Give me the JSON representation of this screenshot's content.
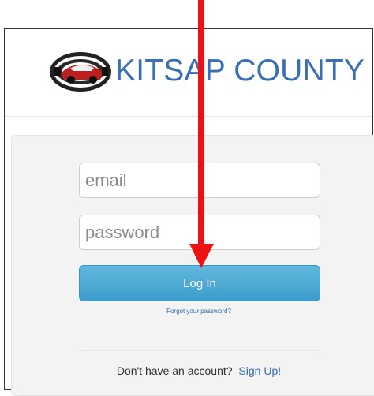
{
  "header": {
    "brand_title": "KITSAP COUNTY",
    "brand_color": "#3a6fb5"
  },
  "login_form": {
    "email_placeholder": "email",
    "password_placeholder": "password",
    "login_label": "Log In",
    "forgot_password_label": "Forgot your password?",
    "signup_prompt": "Don't have an account?",
    "signup_label": "Sign Up!",
    "button_color": "#4aa9d6"
  },
  "annotation": {
    "arrow_color": "#ee1111",
    "arrow_icon": "arrow-down-icon"
  }
}
